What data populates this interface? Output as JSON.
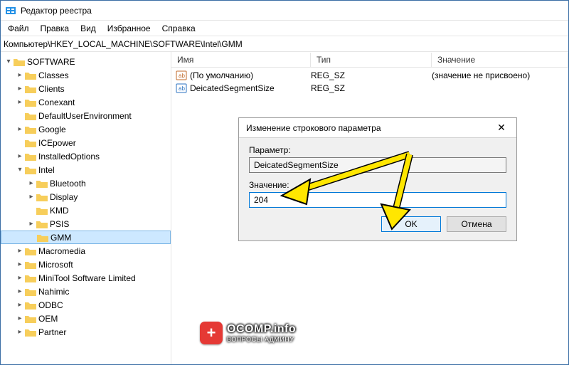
{
  "window": {
    "title": "Редактор реестра"
  },
  "menu": {
    "file": "Файл",
    "edit": "Правка",
    "view": "Вид",
    "favorites": "Избранное",
    "help": "Справка"
  },
  "addressbar": "Компьютер\\HKEY_LOCAL_MACHINE\\SOFTWARE\\Intel\\GMM",
  "tree": {
    "root": "SOFTWARE",
    "items": [
      "Classes",
      "Clients",
      "Conexant",
      "DefaultUserEnvironment",
      "Google",
      "ICEpower",
      "InstalledOptions",
      "Intel"
    ],
    "intel_children": [
      "Bluetooth",
      "Display",
      "KMD",
      "PSIS",
      "GMM"
    ],
    "after_intel": [
      "Macromedia",
      "Microsoft",
      "MiniTool Software Limited",
      "Nahimic",
      "ODBC",
      "OEM",
      "Partner"
    ]
  },
  "list": {
    "headers": {
      "name": "Имя",
      "type": "Тип",
      "value": "Значение"
    },
    "rows": [
      {
        "name": "(По умолчанию)",
        "type": "REG_SZ",
        "value": "(значение не присвоено)"
      },
      {
        "name": "DeicatedSegmentSize",
        "type": "REG_SZ",
        "value": ""
      }
    ]
  },
  "dialog": {
    "title": "Изменение строкового параметра",
    "param_label": "Параметр:",
    "param_value": "DeicatedSegmentSize",
    "value_label": "Значение:",
    "value_value": "204",
    "ok": "OK",
    "cancel": "Отмена"
  },
  "watermark": {
    "line1": "OCOMP.info",
    "line2": "ВОПРОСЫ АДМИНУ"
  }
}
